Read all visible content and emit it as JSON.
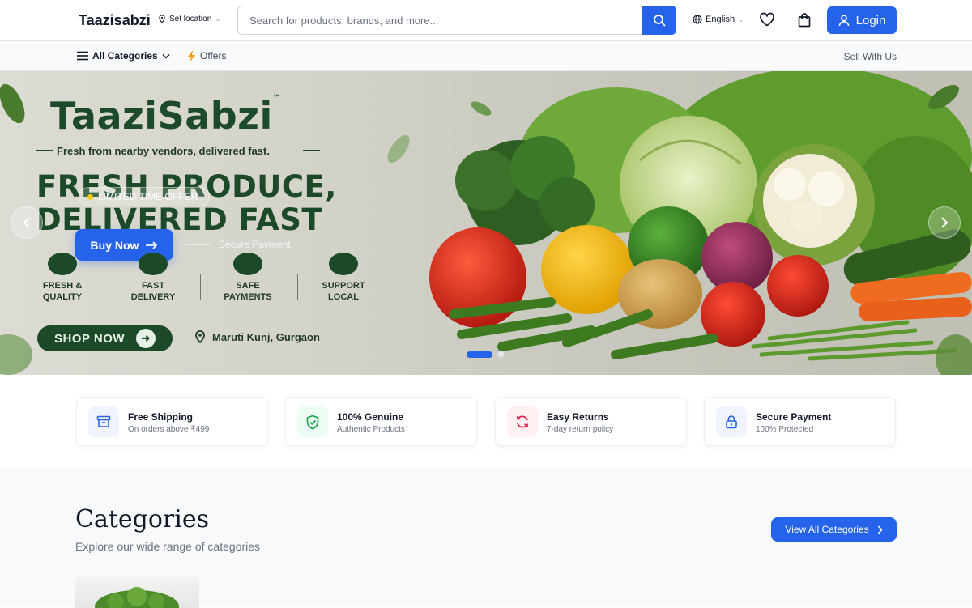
{
  "header": {
    "brand": "Taazisabzi",
    "location_label": "Set location",
    "search_placeholder": "Search for products, brands, and more...",
    "language": "English",
    "login_label": "Login"
  },
  "subnav": {
    "all_categories": "All Categories",
    "offers": "Offers",
    "sell": "Sell With Us"
  },
  "hero": {
    "banner_logo": "TaaziSabzi",
    "banner_tm": "™",
    "banner_tagline": "Fresh from nearby vendors, delivered fast.",
    "banner_heading_line1": "FRESH PRODUCE,",
    "banner_heading_line2": "DELIVERED FAST",
    "badge": "LIMITED TIME OFFER",
    "buy_now": "Buy Now",
    "secure_payment": "Secure Payment",
    "features": [
      {
        "line1": "FRESH &",
        "line2": "QUALITY"
      },
      {
        "line1": "FAST",
        "line2": "DELIVERY"
      },
      {
        "line1": "SAFE",
        "line2": "PAYMENTS"
      },
      {
        "line1": "SUPPORT",
        "line2": "LOCAL"
      }
    ],
    "shop_now": "SHOP NOW",
    "banner_location": "Maruti Kunj, Gurgaon",
    "prev_icon": "chevron-left-icon",
    "next_icon": "chevron-right-icon",
    "slide_count": 2,
    "active_slide": 1
  },
  "benefits": [
    {
      "title": "Free Shipping",
      "subtitle": "On orders above ₹499",
      "icon": "box-icon",
      "color": "#2563eb",
      "bg": "#eff4ff"
    },
    {
      "title": "100% Genuine",
      "subtitle": "Authentic Products",
      "icon": "shield-check-icon",
      "color": "#16a34a",
      "bg": "#ecfdf3"
    },
    {
      "title": "Easy Returns",
      "subtitle": "7-day return policy",
      "icon": "refresh-icon",
      "color": "#e11d48",
      "bg": "#fff1f2"
    },
    {
      "title": "Secure Payment",
      "subtitle": "100% Protected",
      "icon": "lock-icon",
      "color": "#2563eb",
      "bg": "#eff4ff"
    }
  ],
  "categories": {
    "title": "Categories",
    "subtitle": "Explore our wide range of categories",
    "view_all": "View All Categories"
  },
  "colors": {
    "accent": "#2563eb",
    "banner_green": "#1c4a29"
  }
}
